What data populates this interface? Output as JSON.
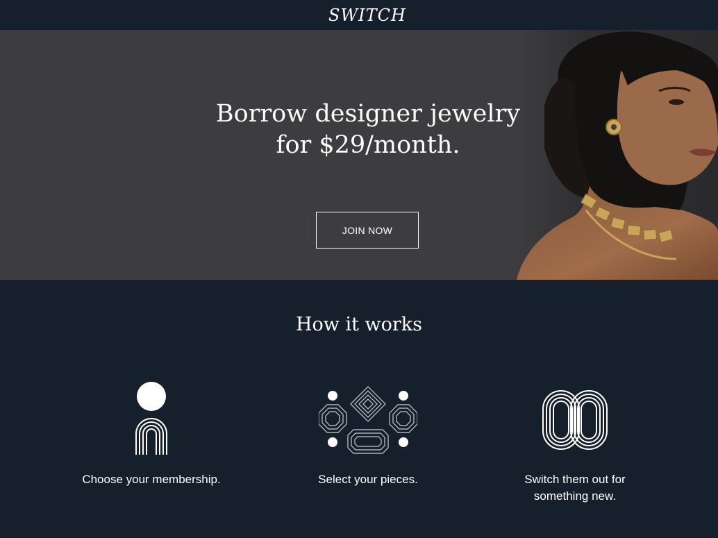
{
  "header": {
    "logo": "SWITCH"
  },
  "hero": {
    "headline_line1": "Borrow designer jewelry",
    "headline_line2": "for $29/month.",
    "cta_label": "JOIN NOW"
  },
  "how_it_works": {
    "title": "How it works",
    "steps": [
      {
        "icon": "membership-icon",
        "caption": "Choose your membership."
      },
      {
        "icon": "jewelry-pieces-icon",
        "caption": "Select your pieces."
      },
      {
        "icon": "switch-loop-icon",
        "caption": "Switch them out for something new."
      }
    ]
  },
  "colors": {
    "page_bg": "#16202c",
    "hero_bg": "#3d3d3f",
    "text": "#ffffff"
  }
}
